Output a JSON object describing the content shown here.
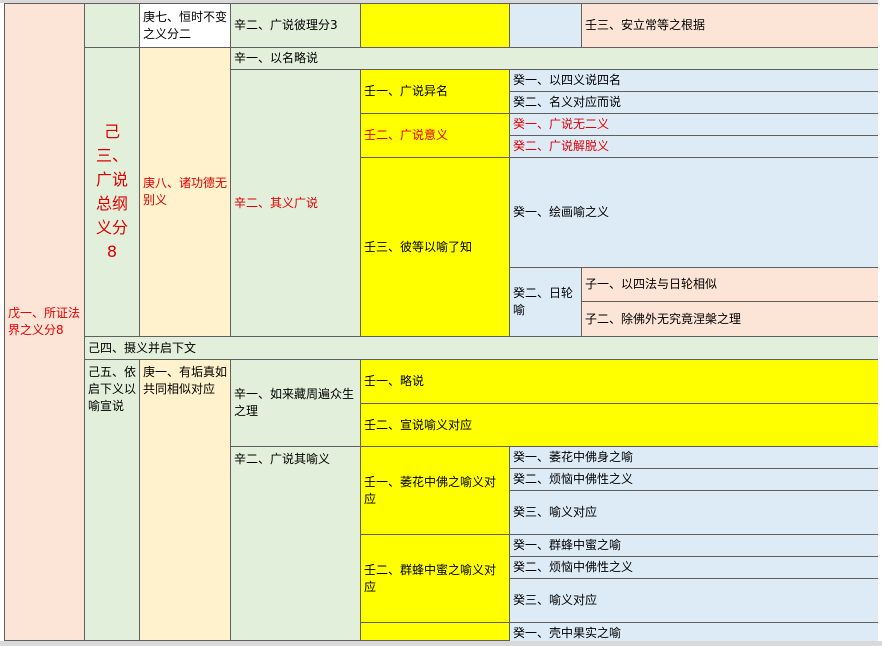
{
  "outline": {
    "wu1": "戊一、所证法界之义分8",
    "ji3": "己三、广说总纲义分8",
    "ji4": "己四、摄义并启下文",
    "ji5": "己五、依启下义以喻宣说",
    "geng7": "庚七、恒时不变之义分二",
    "geng8": "庚八、诸功德无别义",
    "geng1": "庚一、有垢真如共同相似对应",
    "xin2_a": "辛二、广说彼理分3",
    "xin1_a": "辛一、以名略说",
    "xin2_b": "辛二、其义广说",
    "xin1_b": "辛一、如来藏周遍众生之理",
    "xin2_c": "辛二、广说其喻义",
    "ren3_a": "壬三、安立常等之根据",
    "ren1_a": "壬一、广说异名",
    "ren2_a": "壬二、广说意义",
    "ren3_b": "壬三、彼等以喻了知",
    "ren1_b": "壬一、略说",
    "ren2_b": "壬二、宣说喻义对应",
    "ren1_c": "壬一、萎花中佛之喻义对应",
    "ren2_c": "壬二、群蜂中蜜之喻义对应",
    "gui1_a": "癸一、以四义说四名",
    "gui2_a": "癸二、名义对应而说",
    "gui1_b": "癸一、广说无二义",
    "gui2_b": "癸二、广说解脱义",
    "gui1_c": "癸一、绘画喻之义",
    "gui2_c": "癸二、日轮喻",
    "zi1": "子一、以四法与日轮相似",
    "zi2": "子二、除佛外无究竟涅槃之理",
    "gui1_d": "癸一、萎花中佛身之喻",
    "gui2_d": "癸二、烦恼中佛性之义",
    "gui3_d": "癸三、喻义对应",
    "gui1_e": "癸一、群蜂中蜜之喻",
    "gui2_e": "癸二、烦恼中佛性之义",
    "gui3_e": "癸三、喻义对应",
    "gui1_f": "癸一、壳中果实之喻"
  },
  "colors": {
    "pink": "#fce4d6",
    "green": "#e2efda",
    "cream": "#fff2cc",
    "yellow": "#ffff00",
    "blue": "#ddebf7",
    "red_text": "#e00000"
  }
}
